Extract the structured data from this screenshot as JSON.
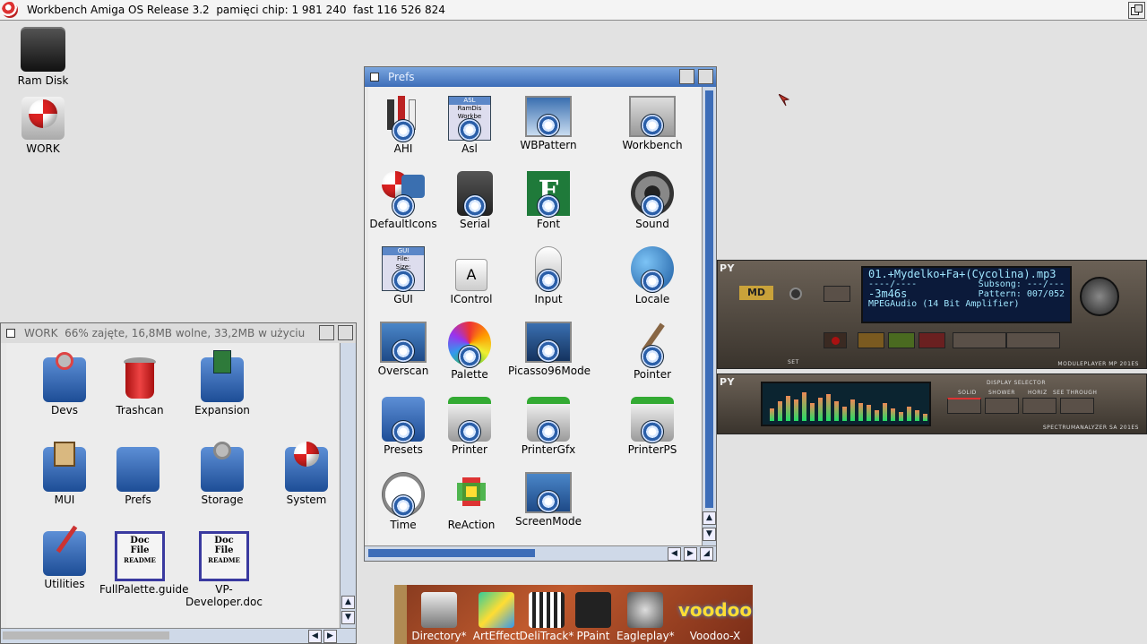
{
  "screen": {
    "title": "Workbench Amiga OS Release 3.2  pamięci chip: 1 981 240  fast 116 526 824"
  },
  "desktop": {
    "icons": [
      {
        "label": "Ram Disk"
      },
      {
        "label": "WORK"
      }
    ]
  },
  "prefs_window": {
    "title": "Prefs",
    "icons": [
      {
        "label": "AHI"
      },
      {
        "label": "Asl"
      },
      {
        "label": "WBPattern"
      },
      {
        "label": "Workbench"
      },
      {
        "label": "DefaultIcons"
      },
      {
        "label": "Serial"
      },
      {
        "label": "Font"
      },
      {
        "label": "Sound"
      },
      {
        "label": "GUI"
      },
      {
        "label": "IControl"
      },
      {
        "label": "Input"
      },
      {
        "label": "Locale"
      },
      {
        "label": "Overscan"
      },
      {
        "label": "Palette"
      },
      {
        "label": "Picasso96Mode"
      },
      {
        "label": "Pointer"
      },
      {
        "label": "Presets"
      },
      {
        "label": "Printer"
      },
      {
        "label": "PrinterGfx"
      },
      {
        "label": "PrinterPS"
      },
      {
        "label": "Time"
      },
      {
        "label": "ReAction"
      },
      {
        "label": "ScreenMode"
      }
    ],
    "asl_icon_text": [
      "ASL",
      "RamDis",
      "Workbe"
    ],
    "gui_icon_text": [
      "GUI",
      "File:",
      "Size:"
    ],
    "font_icon_text": "F"
  },
  "work_window": {
    "title": "WORK  66% zajęte, 16,8MB wolne, 33,2MB w użyciu",
    "icons": [
      {
        "label": "Devs"
      },
      {
        "label": "Trashcan"
      },
      {
        "label": "Expansion"
      },
      {
        "label": "MUI"
      },
      {
        "label": "Prefs"
      },
      {
        "label": "Storage"
      },
      {
        "label": "System"
      },
      {
        "label": "Utilities"
      },
      {
        "label": "FullPalette.guide"
      },
      {
        "label": "VP-Developer.doc"
      }
    ],
    "doc_icon_text": [
      "Doc",
      "File",
      "README"
    ]
  },
  "player": {
    "brand": "PY",
    "md_badge": "MD",
    "line1": "01.+Mydelko+Fa+(Cycolina).mp3",
    "line2": "----/----",
    "line2b": "Subsong: ---/---",
    "line3": "-3m46s",
    "line3b": "Pattern: 007/052",
    "line4": "MPEGAudio (14 Bit Amplifier)",
    "set_label": "SET",
    "footer": "MODULEPLAYER MP 201ES"
  },
  "spectrum": {
    "brand": "PY",
    "selector_title": "DISPLAY SELECTOR",
    "modes": [
      "SOLID",
      "SHOWER",
      "HORIZ",
      "SEE THROUGH"
    ],
    "footer": "SPECTRUMANALYZER SA 201ES",
    "levels": [
      0.35,
      0.55,
      0.7,
      0.6,
      0.8,
      0.5,
      0.65,
      0.75,
      0.55,
      0.4,
      0.6,
      0.5,
      0.45,
      0.3,
      0.5,
      0.35,
      0.25,
      0.4,
      0.3,
      0.2
    ]
  },
  "dock": {
    "items": [
      {
        "label": "Directory*"
      },
      {
        "label": "ArtEffect"
      },
      {
        "label": "DeliTrack*"
      },
      {
        "label": "PPaint"
      },
      {
        "label": "Eagleplay*"
      },
      {
        "label": "Voodoo-X"
      }
    ],
    "voodoo_text": "voodoo"
  }
}
